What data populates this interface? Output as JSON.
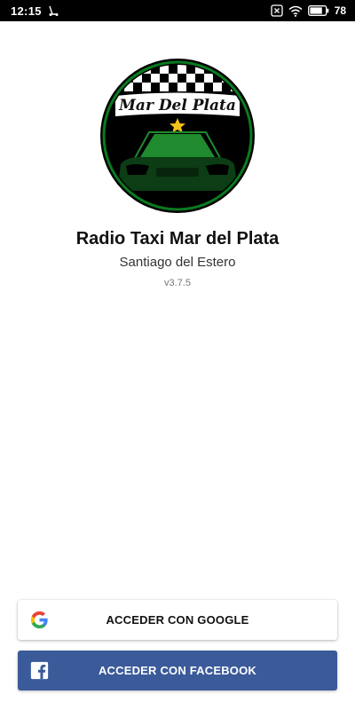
{
  "status_bar": {
    "time": "12:15",
    "battery": "78",
    "icons": [
      "scooter-icon",
      "close-box-icon",
      "wifi-icon",
      "battery-icon"
    ]
  },
  "logo": {
    "text": "Mar Del Plata",
    "colors": {
      "ring": "#0a7a1f",
      "background": "#000000",
      "accent": "#1f8a2e",
      "star": "#f2c21b"
    }
  },
  "app": {
    "name": "Radio Taxi Mar del Plata",
    "city": "Santiago del Estero",
    "version": "v3.7.5"
  },
  "buttons": {
    "google": {
      "label": "ACCEDER CON GOOGLE",
      "icon": "google-icon"
    },
    "facebook": {
      "label": "ACCEDER CON FACEBOOK",
      "icon": "facebook-icon",
      "color": "#3b5a9a"
    }
  }
}
